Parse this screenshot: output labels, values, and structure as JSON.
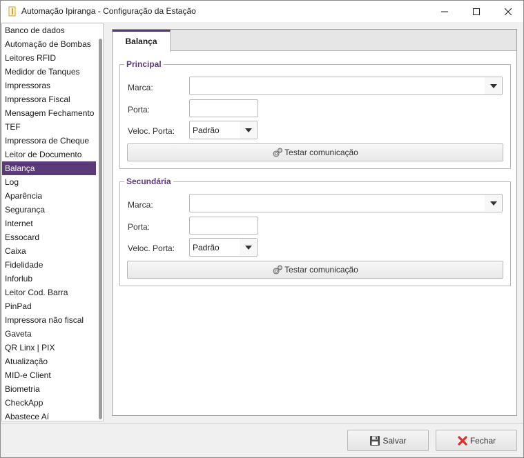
{
  "window": {
    "title": "Automação Ipiranga - Configuração da Estação"
  },
  "sidebar": {
    "selected_index": 10,
    "items": [
      {
        "label": "Banco de dados"
      },
      {
        "label": "Automação de Bombas"
      },
      {
        "label": "Leitores RFID"
      },
      {
        "label": "Medidor de Tanques"
      },
      {
        "label": "Impressoras"
      },
      {
        "label": "Impressora Fiscal"
      },
      {
        "label": "Mensagem Fechamento"
      },
      {
        "label": "TEF"
      },
      {
        "label": "Impressora de Cheque"
      },
      {
        "label": "Leitor de Documento"
      },
      {
        "label": "Balança"
      },
      {
        "label": "Log"
      },
      {
        "label": "Aparência"
      },
      {
        "label": "Segurança"
      },
      {
        "label": "Internet"
      },
      {
        "label": "Essocard"
      },
      {
        "label": "Caixa"
      },
      {
        "label": "Fidelidade"
      },
      {
        "label": "Inforlub"
      },
      {
        "label": "Leitor Cod. Barra"
      },
      {
        "label": "PinPad"
      },
      {
        "label": "Impressora não fiscal"
      },
      {
        "label": "Gaveta"
      },
      {
        "label": "QR Linx | PIX"
      },
      {
        "label": "Atualização"
      },
      {
        "label": "MID-e Client"
      },
      {
        "label": "Biometria"
      },
      {
        "label": "CheckApp"
      },
      {
        "label": "Abastece Aí"
      }
    ]
  },
  "tab": {
    "label": "Balança"
  },
  "principal": {
    "title": "Principal",
    "marca_label": "Marca:",
    "marca_value": "",
    "porta_label": "Porta:",
    "porta_value": "",
    "veloc_label": "Veloc. Porta:",
    "veloc_value": "Padrão",
    "test_label": "Testar comunicação"
  },
  "secundaria": {
    "title": "Secundária",
    "marca_label": "Marca:",
    "marca_value": "",
    "porta_label": "Porta:",
    "porta_value": "",
    "veloc_label": "Veloc. Porta:",
    "veloc_value": "Padrão",
    "test_label": "Testar comunicação"
  },
  "footer": {
    "save_label": "Salvar",
    "close_label": "Fechar"
  },
  "colors": {
    "accent": "#5b3a7a",
    "close_red": "#d9302c"
  },
  "icons": {
    "app": "app-icon",
    "save": "floppy-disk-icon",
    "close": "red-x-icon",
    "test": "gears-icon"
  }
}
